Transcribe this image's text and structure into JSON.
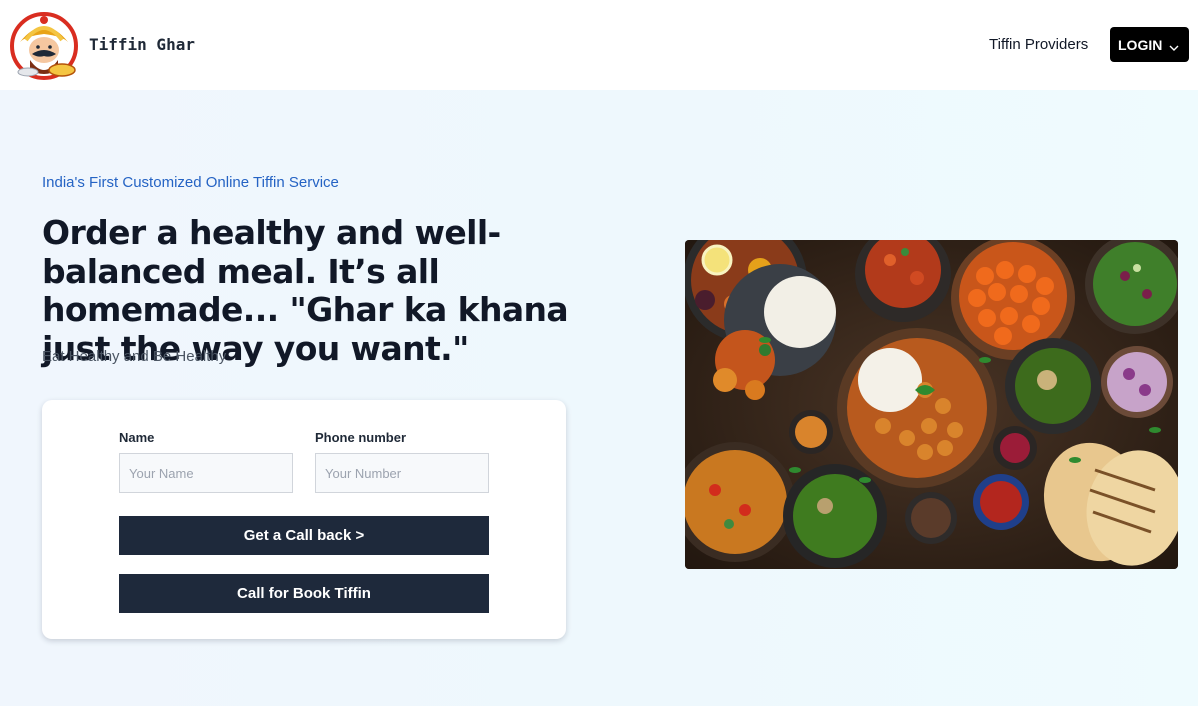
{
  "header": {
    "brand_name": "Tiffin Ghar",
    "nav_link": "Tiffin Providers",
    "login_label": "LOGIN"
  },
  "hero": {
    "tagline": "India's First Customized Online Tiffin Service",
    "headline": "Order a healthy and well-balanced meal. It’s all homemade... \"Ghar ka khana just the way you want.\"",
    "subline": "Eat Healthy and Be Healthy"
  },
  "form": {
    "name_label": "Name",
    "name_placeholder": "Your Name",
    "name_value": "",
    "phone_label": "Phone number",
    "phone_placeholder": "Your Number",
    "phone_value": "",
    "callback_button": "Get a Call back >",
    "book_button": "Call for Book Tiffin"
  },
  "icons": {
    "logo": "chef-mascot-logo",
    "login_dropdown": "chevron-down-icon"
  },
  "colors": {
    "accent_blue": "#2563c4",
    "button_dark": "#1e293b",
    "login_bg": "#000000",
    "hero_bg": "#eef7fd"
  }
}
